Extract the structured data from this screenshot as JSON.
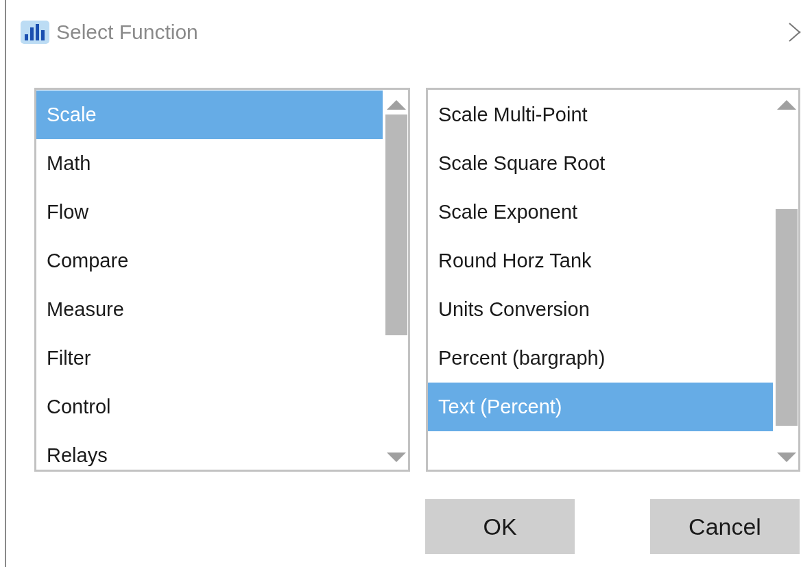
{
  "window": {
    "title": "Select Function"
  },
  "categories": [
    {
      "label": "Scale",
      "selected": true
    },
    {
      "label": "Math",
      "selected": false
    },
    {
      "label": "Flow",
      "selected": false
    },
    {
      "label": "Compare",
      "selected": false
    },
    {
      "label": "Measure",
      "selected": false
    },
    {
      "label": "Filter",
      "selected": false
    },
    {
      "label": "Control",
      "selected": false
    },
    {
      "label": "Relays",
      "selected": false
    }
  ],
  "functions": [
    {
      "label": "Scale Multi-Point",
      "selected": false
    },
    {
      "label": "Scale Square Root",
      "selected": false
    },
    {
      "label": "Scale Exponent",
      "selected": false
    },
    {
      "label": "Round Horz Tank",
      "selected": false
    },
    {
      "label": "Units Conversion",
      "selected": false
    },
    {
      "label": "Percent (bargraph)",
      "selected": false
    },
    {
      "label": "Text (Percent)",
      "selected": true
    }
  ],
  "buttons": [
    {
      "label": "OK"
    },
    {
      "label": "Cancel"
    }
  ]
}
